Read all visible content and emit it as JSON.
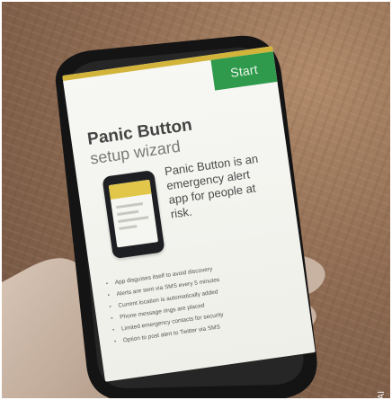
{
  "screen": {
    "start_label": "Start",
    "title": "Panic Button",
    "subtitle": "setup wizard",
    "description": "Panic Button is an emergency alert app for people at risk.",
    "features": [
      "App disguises itself to avoid discovery",
      "Alerts are sent via SMS every 5 minutes",
      "Current location is automatically added",
      "Phone message rings are placed",
      "Limited emergency contacts for security",
      "Option to post alert to Twitter via SMS"
    ]
  },
  "photo": {
    "copyright": "© AI"
  },
  "colors": {
    "start_button": "#2f9a4c",
    "accent_bar": "#d2b43a",
    "phone_body": "#1d1f22",
    "table_wood": "#8e6b52"
  },
  "icons": {
    "phone_illustration": "smartphone-illustration"
  }
}
